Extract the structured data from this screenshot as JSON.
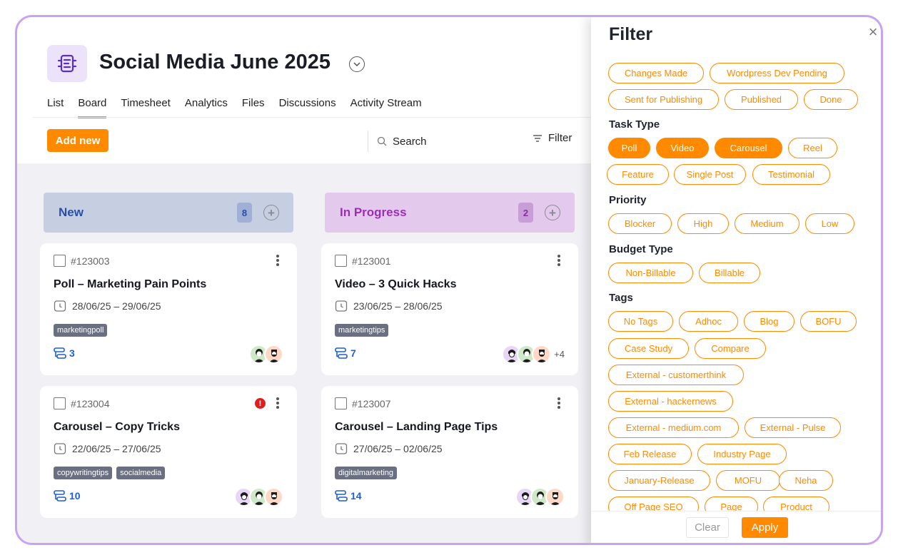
{
  "project": {
    "title": "Social Media June 2025"
  },
  "tabs": [
    {
      "label": "List"
    },
    {
      "label": "Board"
    },
    {
      "label": "Timesheet"
    },
    {
      "label": "Analytics"
    },
    {
      "label": "Files"
    },
    {
      "label": "Discussions"
    },
    {
      "label": "Activity Stream"
    }
  ],
  "active_tab": "Board",
  "toolbar": {
    "add_label": "Add new",
    "search_label": "Search",
    "filter_label": "Filter"
  },
  "columns": [
    {
      "name": "New",
      "count": "8",
      "color": "#c6cfe2"
    },
    {
      "name": "In Progress",
      "count": "2",
      "color": "#e3c9ec"
    }
  ],
  "cards": [
    {
      "id": "#123003",
      "title": "Poll – Marketing Pain Points",
      "dates": "28/06/25 – 29/06/25",
      "tags": [
        "marketingpoll"
      ],
      "subtasks": "3",
      "flagged": false,
      "more": ""
    },
    {
      "id": "#123001",
      "title": "Video – 3 Quick Hacks",
      "dates": "23/06/25 – 28/06/25",
      "tags": [
        "marketingtips"
      ],
      "subtasks": "7",
      "flagged": false,
      "more": "+4"
    },
    {
      "id": "#123004",
      "title": "Carousel – Copy Tricks",
      "dates": "22/06/25 – 27/06/25",
      "tags": [
        "copywritingtips",
        "socialmedia"
      ],
      "subtasks": "10",
      "flagged": true,
      "more": ""
    },
    {
      "id": "#123007",
      "title": "Carousel – Landing Page Tips",
      "dates": "27/06/25 – 02/06/25",
      "tags": [
        "digitalmarketing"
      ],
      "subtasks": "14",
      "flagged": false,
      "more": ""
    }
  ],
  "filter": {
    "title": "Filter",
    "status_chips": [
      "Changes Made",
      "Wordpress Dev Pending",
      "Sent for Publishing",
      "Published",
      "Done"
    ],
    "task_type_label": "Task Type",
    "task_types": [
      "Poll",
      "Video",
      "Carousel",
      "Reel",
      "Feature",
      "Single Post",
      "Testimonial"
    ],
    "task_types_selected": [
      "Poll",
      "Video",
      "Carousel"
    ],
    "priority_label": "Priority",
    "priorities": [
      "Blocker",
      "High",
      "Medium",
      "Low"
    ],
    "budget_label": "Budget Type",
    "budgets": [
      "Non-Billable",
      "Billable"
    ],
    "tags_label": "Tags",
    "tags": [
      "No Tags",
      "Adhoc",
      "Blog",
      "BOFU",
      "Case Study",
      "Compare",
      "External - customerthink",
      "External - hackernews",
      "External - medium.com",
      "External - Pulse",
      "Feb Release",
      "Industry Page",
      "January-Release",
      "MOFU",
      "Neha",
      "Off Page SEO",
      "Page",
      "Product"
    ],
    "clear_label": "Clear",
    "apply_label": "Apply"
  },
  "colors": {
    "accent": "#ff8a00",
    "frame": "#c9a3f0",
    "subtask_blue": "#1c5fd6",
    "alert_red": "#e21c1c"
  }
}
